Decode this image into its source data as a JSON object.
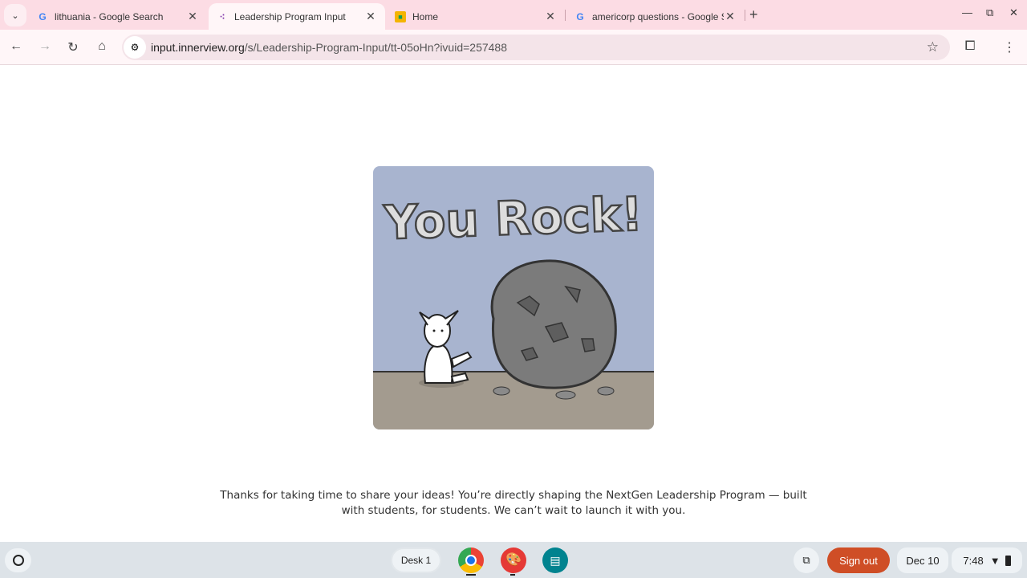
{
  "tabs": [
    {
      "title": "lithuania - Google Search",
      "icon": "google-icon"
    },
    {
      "title": "Leadership Program Input",
      "icon": "innerview-icon",
      "active": true
    },
    {
      "title": "Home",
      "icon": "classroom-icon"
    },
    {
      "title": "americorp questions - Google S",
      "icon": "google-icon"
    }
  ],
  "toolbar": {
    "url_host": "input.innerview.org",
    "url_path": "/s/Leadership-Program-Input/tt-05oHn?ivuid=257488"
  },
  "page": {
    "illustration_text": "You Rock!",
    "message": "Thanks for taking  time to share your ideas! You’re directly shaping the NextGen Leadership Program — built with students, for students. We can’t wait to launch it with you."
  },
  "shelf": {
    "desk": "Desk 1",
    "sign_out": "Sign out",
    "date": "Dec 10",
    "time": "7:48"
  },
  "colors": {
    "accent_signout": "#cf4e26",
    "tabbar": "#fcdce4"
  }
}
